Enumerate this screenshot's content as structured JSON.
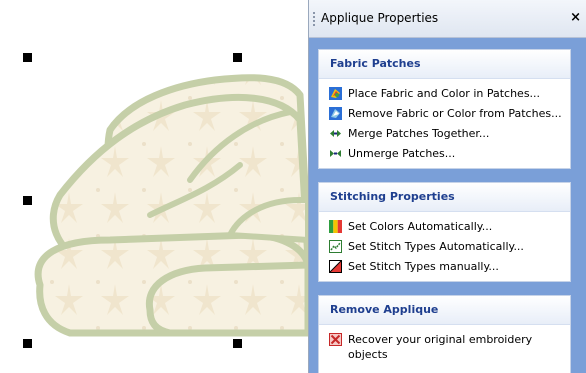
{
  "panel": {
    "title": "Applique Properties",
    "close_label": "×"
  },
  "groups": [
    {
      "header": "Fabric Patches",
      "items": [
        {
          "label": "Place Fabric and Color in Patches...",
          "icon": "place-fabric-icon"
        },
        {
          "label": "Remove Fabric or Color from Patches...",
          "icon": "remove-fabric-icon"
        },
        {
          "label": "Merge Patches Together...",
          "icon": "merge-patches-icon"
        },
        {
          "label": "Unmerge Patches...",
          "icon": "unmerge-patches-icon"
        }
      ]
    },
    {
      "header": "Stitching Properties",
      "items": [
        {
          "label": "Set Colors Automatically...",
          "icon": "set-colors-icon"
        },
        {
          "label": "Set Stitch Types Automatically...",
          "icon": "stitch-types-auto-icon"
        },
        {
          "label": "Set Stitch Types manually...",
          "icon": "stitch-types-manual-icon"
        }
      ]
    },
    {
      "header": "Remove Applique",
      "items": [
        {
          "label": "Recover your original embroidery objects",
          "icon": "recover-objects-icon"
        }
      ]
    }
  ],
  "colors": {
    "panel_background": "#7a9fd8",
    "group_header_text": "#1f3f8f",
    "applique_fill": "#f6f0df",
    "applique_outline": "#c5cfa8"
  }
}
